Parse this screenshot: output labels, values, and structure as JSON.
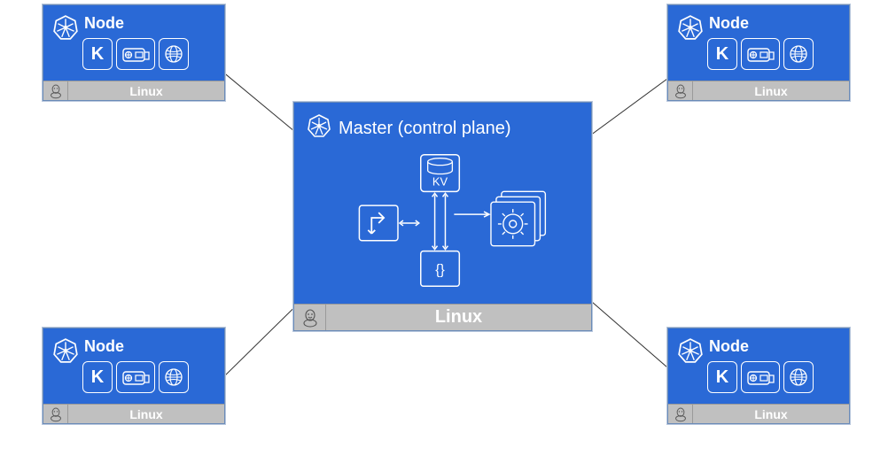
{
  "master": {
    "title": "Master (control plane)",
    "os": "Linux",
    "kv_label": "KV",
    "scheduler_label": "{}"
  },
  "nodes": {
    "top_left": {
      "title": "Node",
      "os": "Linux",
      "k_label": "K"
    },
    "top_right": {
      "title": "Node",
      "os": "Linux",
      "k_label": "K"
    },
    "bottom_left": {
      "title": "Node",
      "os": "Linux",
      "k_label": "K"
    },
    "bottom_right": {
      "title": "Node",
      "os": "Linux",
      "k_label": "K"
    }
  },
  "colors": {
    "k8s_blue": "#2a69d6",
    "footer_grey": "#c0c0c0"
  }
}
